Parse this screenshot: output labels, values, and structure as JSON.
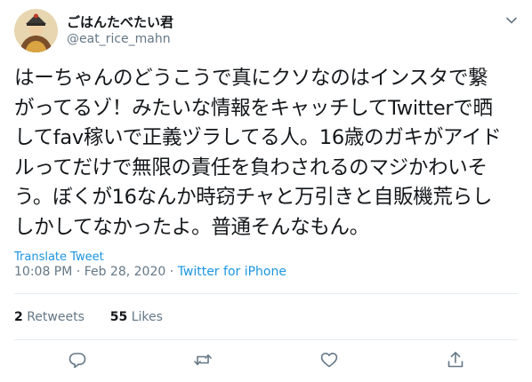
{
  "author": {
    "display_name": "ごはんたべたい君",
    "handle": "@eat_rice_mahn"
  },
  "tweet": {
    "text": "はーちゃんのどうこうで真にクソなのはインスタで繋\nがってるゾ！みたいな情報をキャッチしてTwitterで晒\nしてfav稼いで正義ヅラしてる人。16歳のガキがアイド\nルってだけで無限の責任を負わされるのマジかわいそ\nう。ぼくが16なんか時窃チャと万引きと自販機荒らし\nしかしてなかったよ。普通そんなもん。",
    "translate_label": "Translate Tweet",
    "time": "10:08 PM",
    "date": "Feb 28, 2020",
    "source": "Twitter for iPhone"
  },
  "stats": {
    "retweets_count": "2",
    "retweets_label": "Retweets",
    "likes_count": "55",
    "likes_label": "Likes"
  },
  "icons": {
    "more": "chevron-down-icon",
    "reply": "reply-icon",
    "retweet": "retweet-icon",
    "like": "heart-icon",
    "share": "share-icon"
  },
  "colors": {
    "link": "#1b95e0",
    "secondary": "#657786",
    "text": "#14171a",
    "divider": "#e6ecf0"
  }
}
